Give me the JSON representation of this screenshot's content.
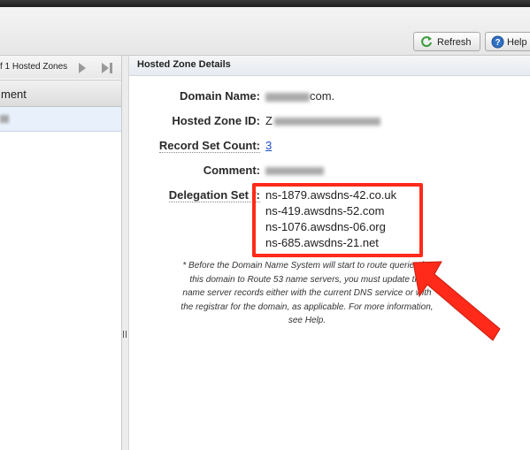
{
  "toolbar": {
    "refresh_label": "Refresh",
    "help_label": "Help"
  },
  "zone_list": {
    "pager_text": "f 1 Hosted Zones",
    "column_header": "ment"
  },
  "details": {
    "title": "Hosted Zone Details",
    "domain_label": "Domain Name:",
    "domain_value_suffix": "com.",
    "zone_id_label": "Hosted Zone ID:",
    "zone_id_prefix": "Z",
    "count_label": "Record Set Count:",
    "count_value": "3",
    "comment_label": "Comment:",
    "delegation_label": "Delegation Set *:",
    "name_servers": [
      "ns-1879.awsdns-42.co.uk",
      "ns-419.awsdns-52.com",
      "ns-1076.awsdns-06.org",
      "ns-685.awsdns-21.net"
    ],
    "footnote": "* Before the Domain Name System will start to route queries for this domain to Route 53 name servers, you must update the name server records either with the current DNS service or with the registrar for the domain, as applicable. For more information, see Help."
  },
  "colors": {
    "highlight": "#ff2a1a",
    "link": "#1a4fc4",
    "selected_row": "#e7f0fb"
  },
  "icons": [
    "refresh-icon",
    "help-icon",
    "next-page-icon",
    "last-page-icon",
    "splitter-grip-icon",
    "annotation-arrow"
  ]
}
